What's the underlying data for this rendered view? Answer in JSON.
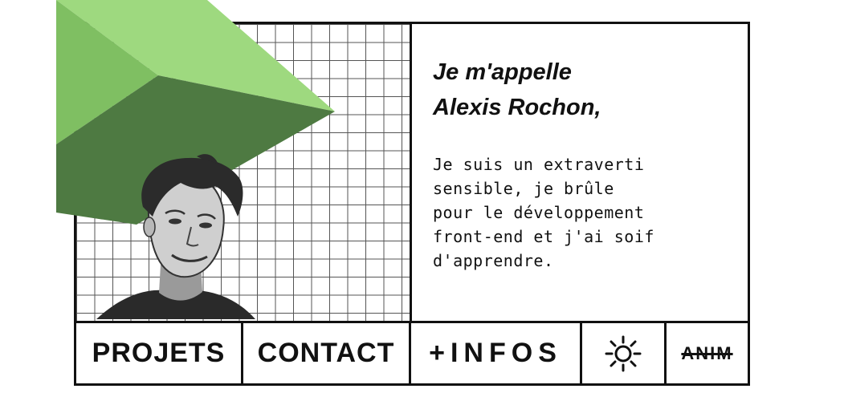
{
  "headline": {
    "line1": "Je m'appelle",
    "line2": "Alexis Rochon,"
  },
  "bio": {
    "lines": [
      "Je suis un extraverti",
      "sensible, je brûle",
      "pour le développement",
      "front-end et j'ai soif",
      "d'apprendre."
    ]
  },
  "nav": {
    "projets": "PROJETS",
    "contact": "CONTACT",
    "infos": "+INFOS",
    "theme_icon": "sun-icon",
    "anim": "ANIM"
  },
  "colors": {
    "shape_light": "#9ed97f",
    "shape_mid": "#6fae52",
    "shape_dark": "#3f6b35",
    "border": "#111111"
  }
}
